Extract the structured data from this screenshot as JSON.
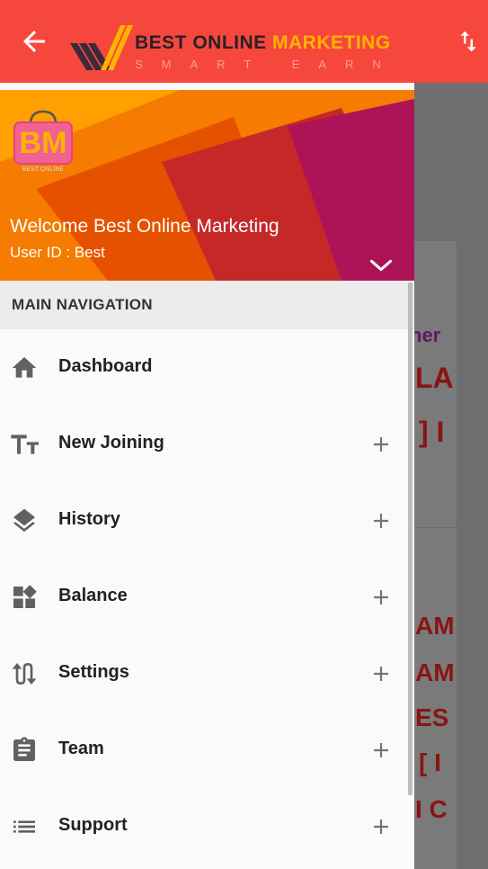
{
  "appbar": {
    "logo_line1_dark": "BEST ONLINE ",
    "logo_line1_light": "MARKETING",
    "logo_line2": "SMART EARN",
    "back_icon": "arrow-back-icon",
    "sort_icon": "swap-vertical-icon",
    "color": "#f6473c"
  },
  "background": {
    "texts": [
      "ner",
      "LA",
      "] I",
      "AM",
      "AM",
      "ES",
      "[ I",
      "I C"
    ],
    "colors": {
      "purple": "#6a1b6a",
      "red": "#b71c1c"
    }
  },
  "drawer": {
    "header": {
      "welcome": "Welcome Best Online Marketing",
      "user_id": "User ID : Best",
      "avatar_caption": "BEST ONLINE",
      "expand_icon": "chevron-down-icon"
    },
    "section_title": "MAIN NAVIGATION",
    "items": [
      {
        "label": "Dashboard",
        "icon": "home-icon",
        "expandable": false
      },
      {
        "label": "New Joining",
        "icon": "text-size-icon",
        "expandable": true
      },
      {
        "label": "History",
        "icon": "layers-icon",
        "expandable": true
      },
      {
        "label": "Balance",
        "icon": "widgets-icon",
        "expandable": true
      },
      {
        "label": "Settings",
        "icon": "swap-arrows-icon",
        "expandable": true
      },
      {
        "label": "Team",
        "icon": "clipboard-icon",
        "expandable": true
      },
      {
        "label": "Support",
        "icon": "list-icon",
        "expandable": true
      }
    ]
  }
}
